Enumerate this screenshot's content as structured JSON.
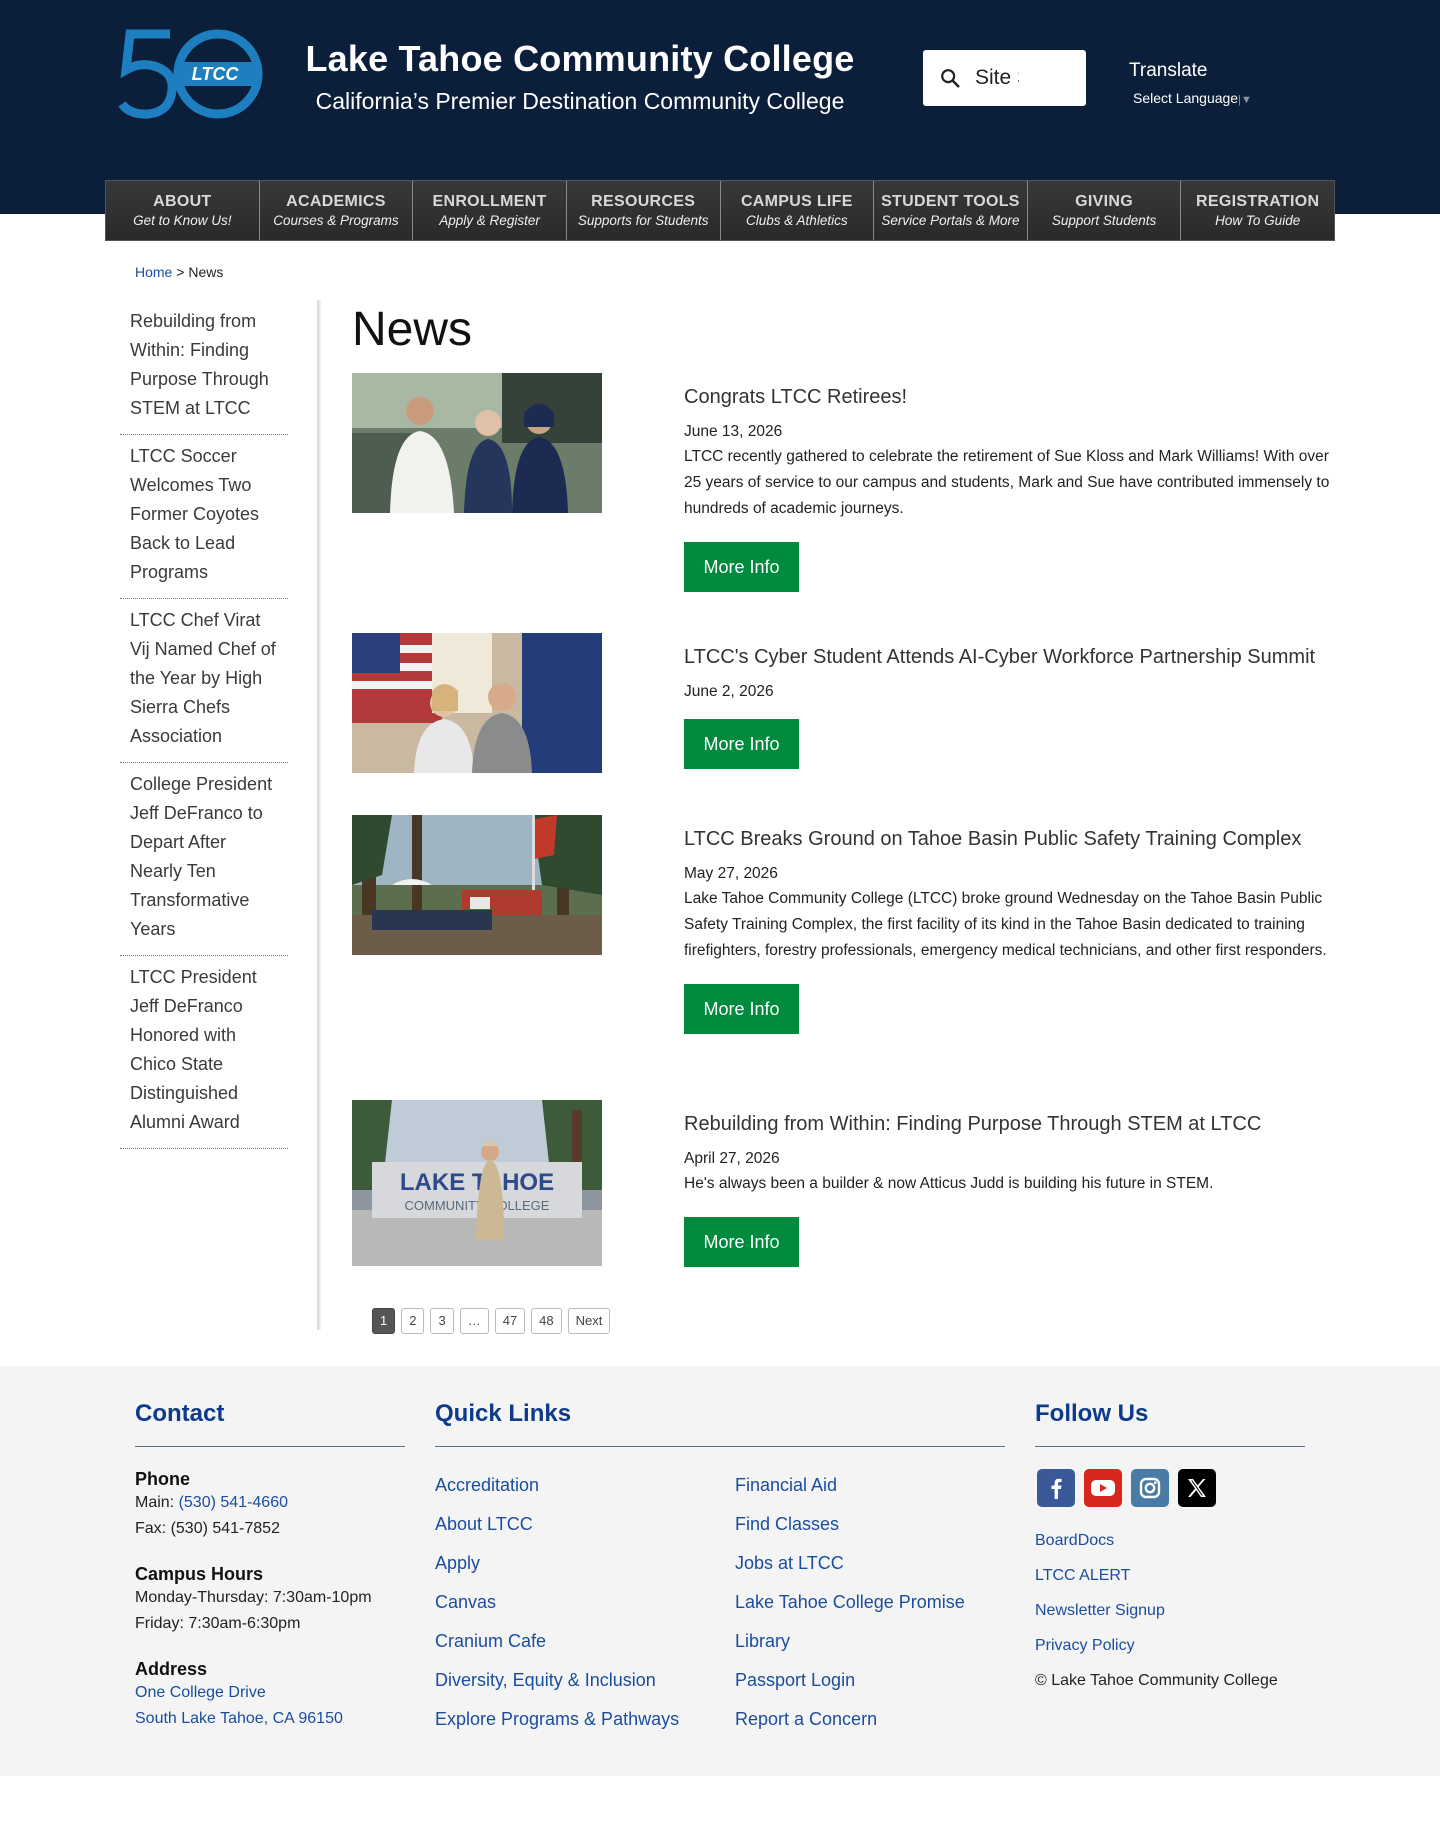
{
  "header": {
    "logo_text": "LTCC",
    "logo_number": "50",
    "title": "Lake Tahoe Community College",
    "subtitle": "California’s Premier Destination Community College",
    "search_value": "Site Search",
    "translate_title": "Translate",
    "translate_select": "Select Language"
  },
  "nav": [
    {
      "label": "ABOUT",
      "sub": "Get to Know Us!"
    },
    {
      "label": "ACADEMICS",
      "sub": "Courses & Programs"
    },
    {
      "label": "ENROLLMENT",
      "sub": "Apply & Register"
    },
    {
      "label": "RESOURCES",
      "sub": "Supports for Students"
    },
    {
      "label": "CAMPUS LIFE",
      "sub": "Clubs & Athletics"
    },
    {
      "label": "STUDENT TOOLS",
      "sub": "Service Portals & More"
    },
    {
      "label": "GIVING",
      "sub": "Support Students"
    },
    {
      "label": "REGISTRATION",
      "sub": "How To Guide"
    }
  ],
  "breadcrumb": {
    "home": "Home",
    "sep": ">",
    "current": "News"
  },
  "sidebar": [
    "Rebuilding from Within: Finding Purpose Through STEM at LTCC",
    "LTCC Soccer Welcomes Two Former Coyotes Back to Lead Programs",
    "LTCC Chef Virat Vij Named Chef of the Year by High Sierra Chefs Association",
    "College President Jeff DeFranco to Depart After Nearly Ten Transformative Years",
    "LTCC President Jeff DeFranco Honored with Chico State Distinguished Alumni Award"
  ],
  "page_title": "News",
  "news": [
    {
      "title": "Congrats LTCC Retirees!",
      "date": "June 13, 2026",
      "excerpt": "LTCC recently gathered to celebrate the retirement of Sue Kloss and Mark Williams! With over 25 years of service to our campus and students, Mark and Sue have contributed immensely to hundreds of academic journeys.",
      "button": "More Info"
    },
    {
      "title": "LTCC's Cyber Student Attends AI-Cyber Workforce Partnership Summit",
      "date": "June 2, 2026",
      "excerpt": "",
      "button": "More Info"
    },
    {
      "title": "LTCC Breaks Ground on Tahoe Basin Public Safety Training Complex",
      "date": "May 27, 2026",
      "excerpt": "Lake Tahoe Community College (LTCC) broke ground Wednesday on the Tahoe Basin Public Safety Training Complex, the first facility of its kind in the Tahoe Basin dedicated to training firefighters, forestry professionals, emergency medical technicians, and other first responders.",
      "button": "More Info"
    },
    {
      "title": "Rebuilding from Within: Finding Purpose Through STEM at LTCC",
      "date": "April 27, 2026",
      "excerpt": "He's always been a builder & now Atticus Judd is building his future in STEM.",
      "button": "More Info",
      "sign_text_top": "LAKE TAHOE",
      "sign_text_bottom": "COMMUNITY COLLEGE"
    }
  ],
  "pagination": [
    "1",
    "2",
    "3",
    "…",
    "47",
    "48",
    "Next"
  ],
  "footer": {
    "contact": {
      "heading": "Contact",
      "phone_label": "Phone",
      "main_prefix": "Main:",
      "main_number": "(530) 541-4660",
      "fax": "Fax: (530) 541-7852",
      "hours_label": "Campus Hours",
      "hours_weekday": "Monday-Thursday: 7:30am-10pm",
      "hours_friday": "Friday: 7:30am-6:30pm",
      "address_label": "Address",
      "address_line1": "One College Drive",
      "address_line2": "South Lake Tahoe, CA 96150"
    },
    "quick_links": {
      "heading": "Quick Links",
      "col1": [
        "Accreditation",
        "About LTCC",
        "Apply",
        "Canvas",
        "Cranium Cafe",
        "Diversity, Equity & Inclusion",
        "Explore Programs & Pathways"
      ],
      "col2": [
        "Financial Aid",
        "Find Classes",
        "Jobs at LTCC",
        "Lake Tahoe College Promise",
        "Library",
        "Passport Login",
        "Report a Concern"
      ]
    },
    "follow": {
      "heading": "Follow Us",
      "social_icons": [
        "facebook-icon",
        "youtube-icon",
        "instagram-icon",
        "x-icon"
      ],
      "links": [
        "BoardDocs",
        "LTCC ALERT",
        "Newsletter Signup",
        "Privacy Policy"
      ],
      "copyright": "© Lake Tahoe Community College"
    }
  },
  "colors": {
    "header_bg": "#0b1f3a",
    "nav_bg": "#2f2f2f",
    "button_green": "#008a3d",
    "link_blue": "#1a4d9e",
    "footer_heading": "#0d3a8a",
    "logo_blue": "#1e7fc0"
  }
}
